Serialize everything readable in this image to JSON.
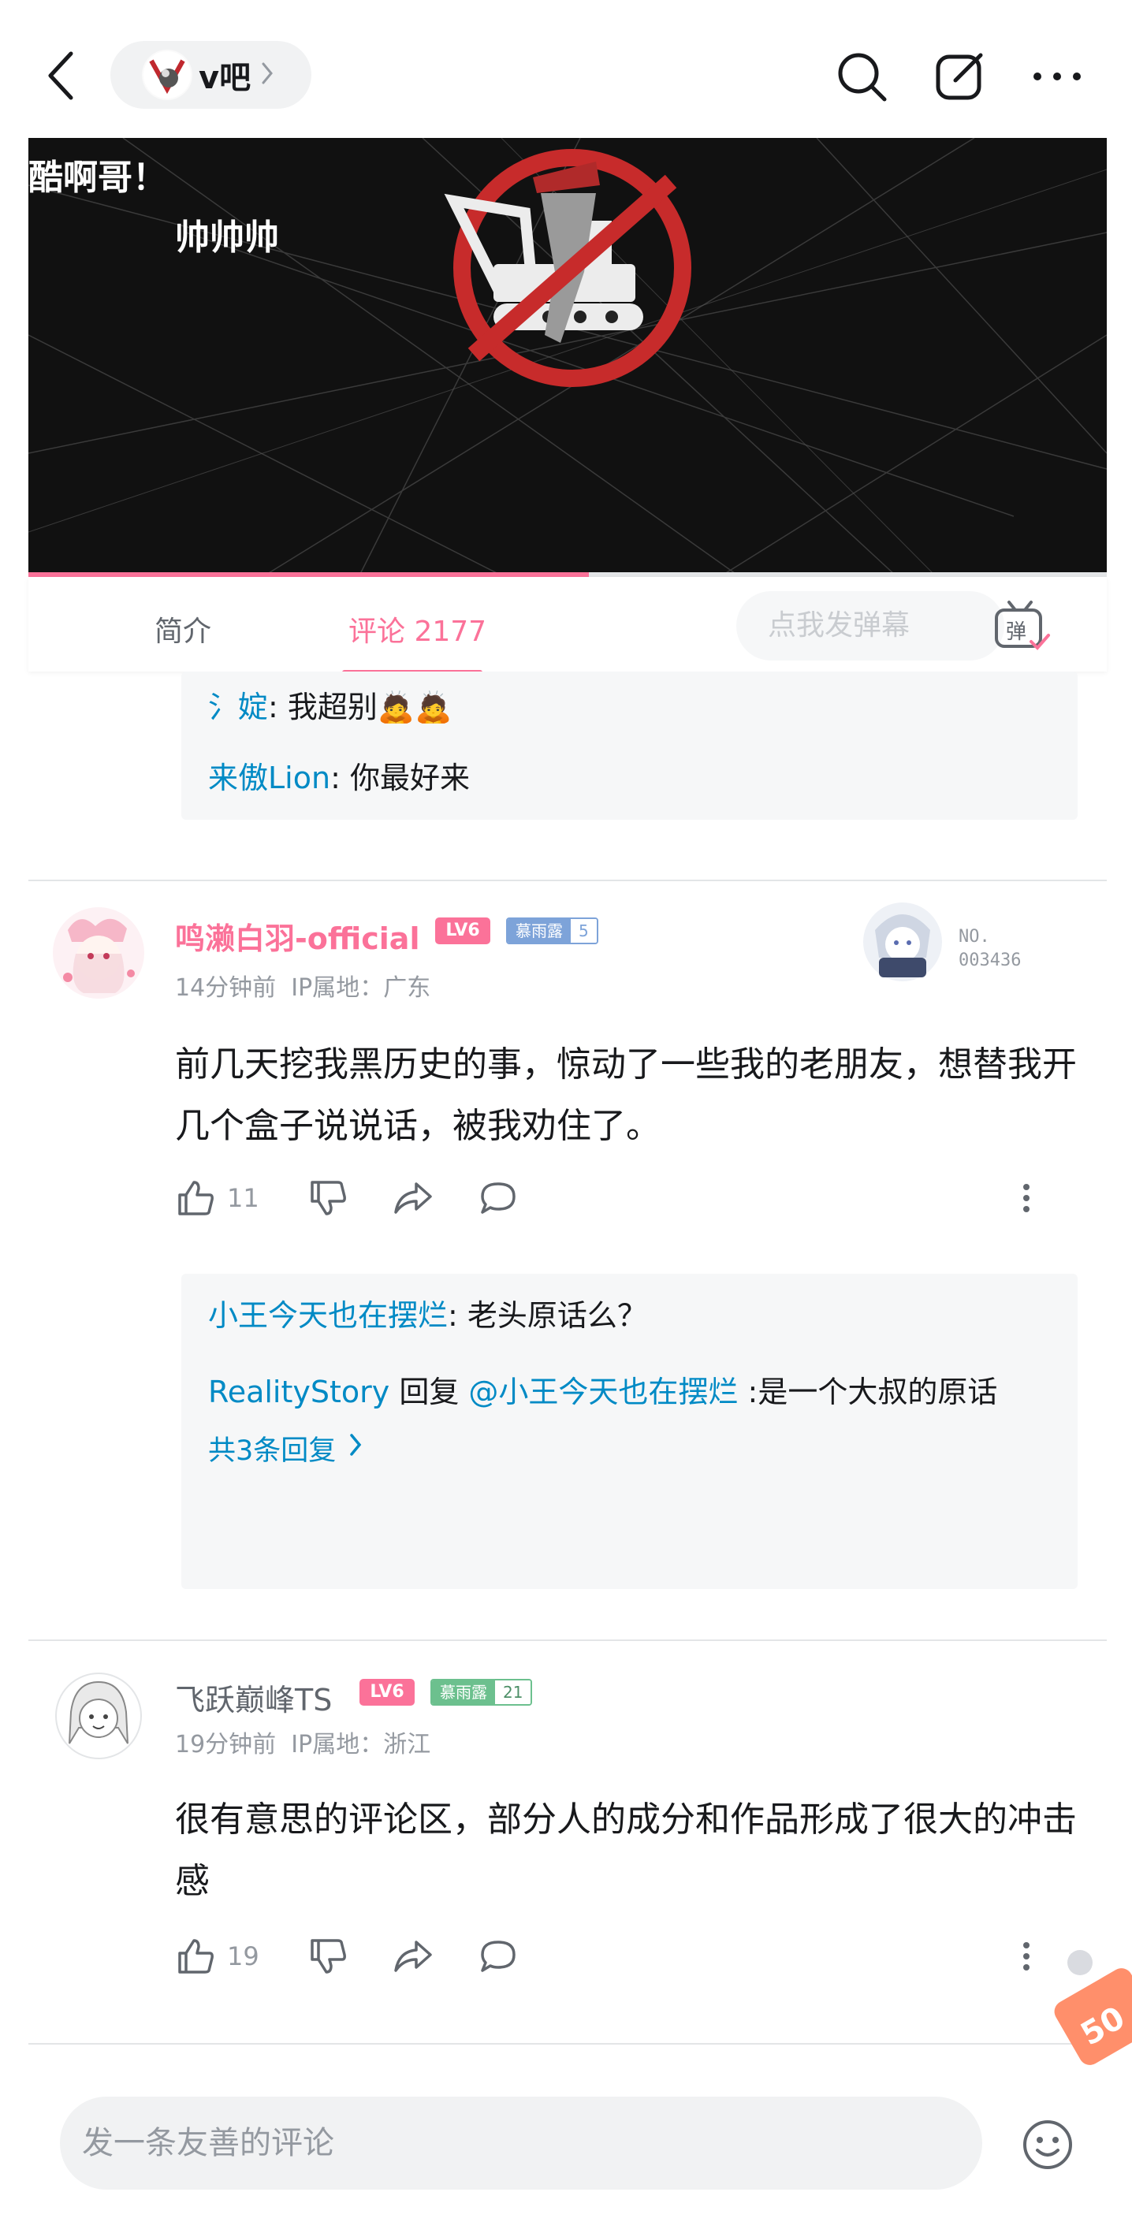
{
  "header": {
    "channel_name": "v吧",
    "icons": [
      "back-icon",
      "chevron-right-icon",
      "search-icon",
      "edit-icon",
      "more-icon"
    ]
  },
  "video": {
    "overlay_text_1": "酷啊哥！",
    "overlay_text_2": "帅帅帅",
    "progress": 0.52
  },
  "tabs": {
    "intro_label": "简介",
    "comments_label": "评论 2177",
    "danmaku_placeholder": "点我发弹幕",
    "danmaku_icon_label": "弹"
  },
  "prev_replies": [
    {
      "user": "氵婝",
      "text": ": 我超别🙇🙇"
    },
    {
      "user": "来傲Lion",
      "text": ": 你最好来"
    }
  ],
  "comments": [
    {
      "username": "鸣濑白羽-official",
      "level": "LV6",
      "medal_name": "慕雨露",
      "medal_level": "5",
      "time": "14分钟前",
      "ip": "IP属地：广东",
      "text": "前几天挖我黑历史的事，惊动了一些我的老朋友，想替我开几个盒子说说话，被我劝住了。",
      "likes": "11",
      "nft_label": "NO.",
      "nft_number": "003436",
      "replies": [
        {
          "user": "小王今天也在摆烂",
          "text": ": 老头原话么？"
        },
        {
          "user": "RealityStory",
          "middle": " 回复 ",
          "mention": "@小王今天也在摆烂",
          "text": " :是一个大叔的原话"
        }
      ],
      "more_replies": "共3条回复"
    },
    {
      "username": "飞跃巅峰TS",
      "level": "LV6",
      "medal_name": "慕雨露",
      "medal_level": "21",
      "time": "19分钟前",
      "ip": "IP属地：浙江",
      "text": "很有意思的评论区，部分人的成分和作品形成了很大的冲击感",
      "likes": "19"
    }
  ],
  "bottom": {
    "input_placeholder": "发一条友善的评论",
    "promo_text": "50"
  },
  "colors": {
    "accent": "#fb7299",
    "link": "#008ac5",
    "muted": "#9499a0",
    "medal_blue": "#7da3d9",
    "medal_green": "#6cc08e"
  }
}
